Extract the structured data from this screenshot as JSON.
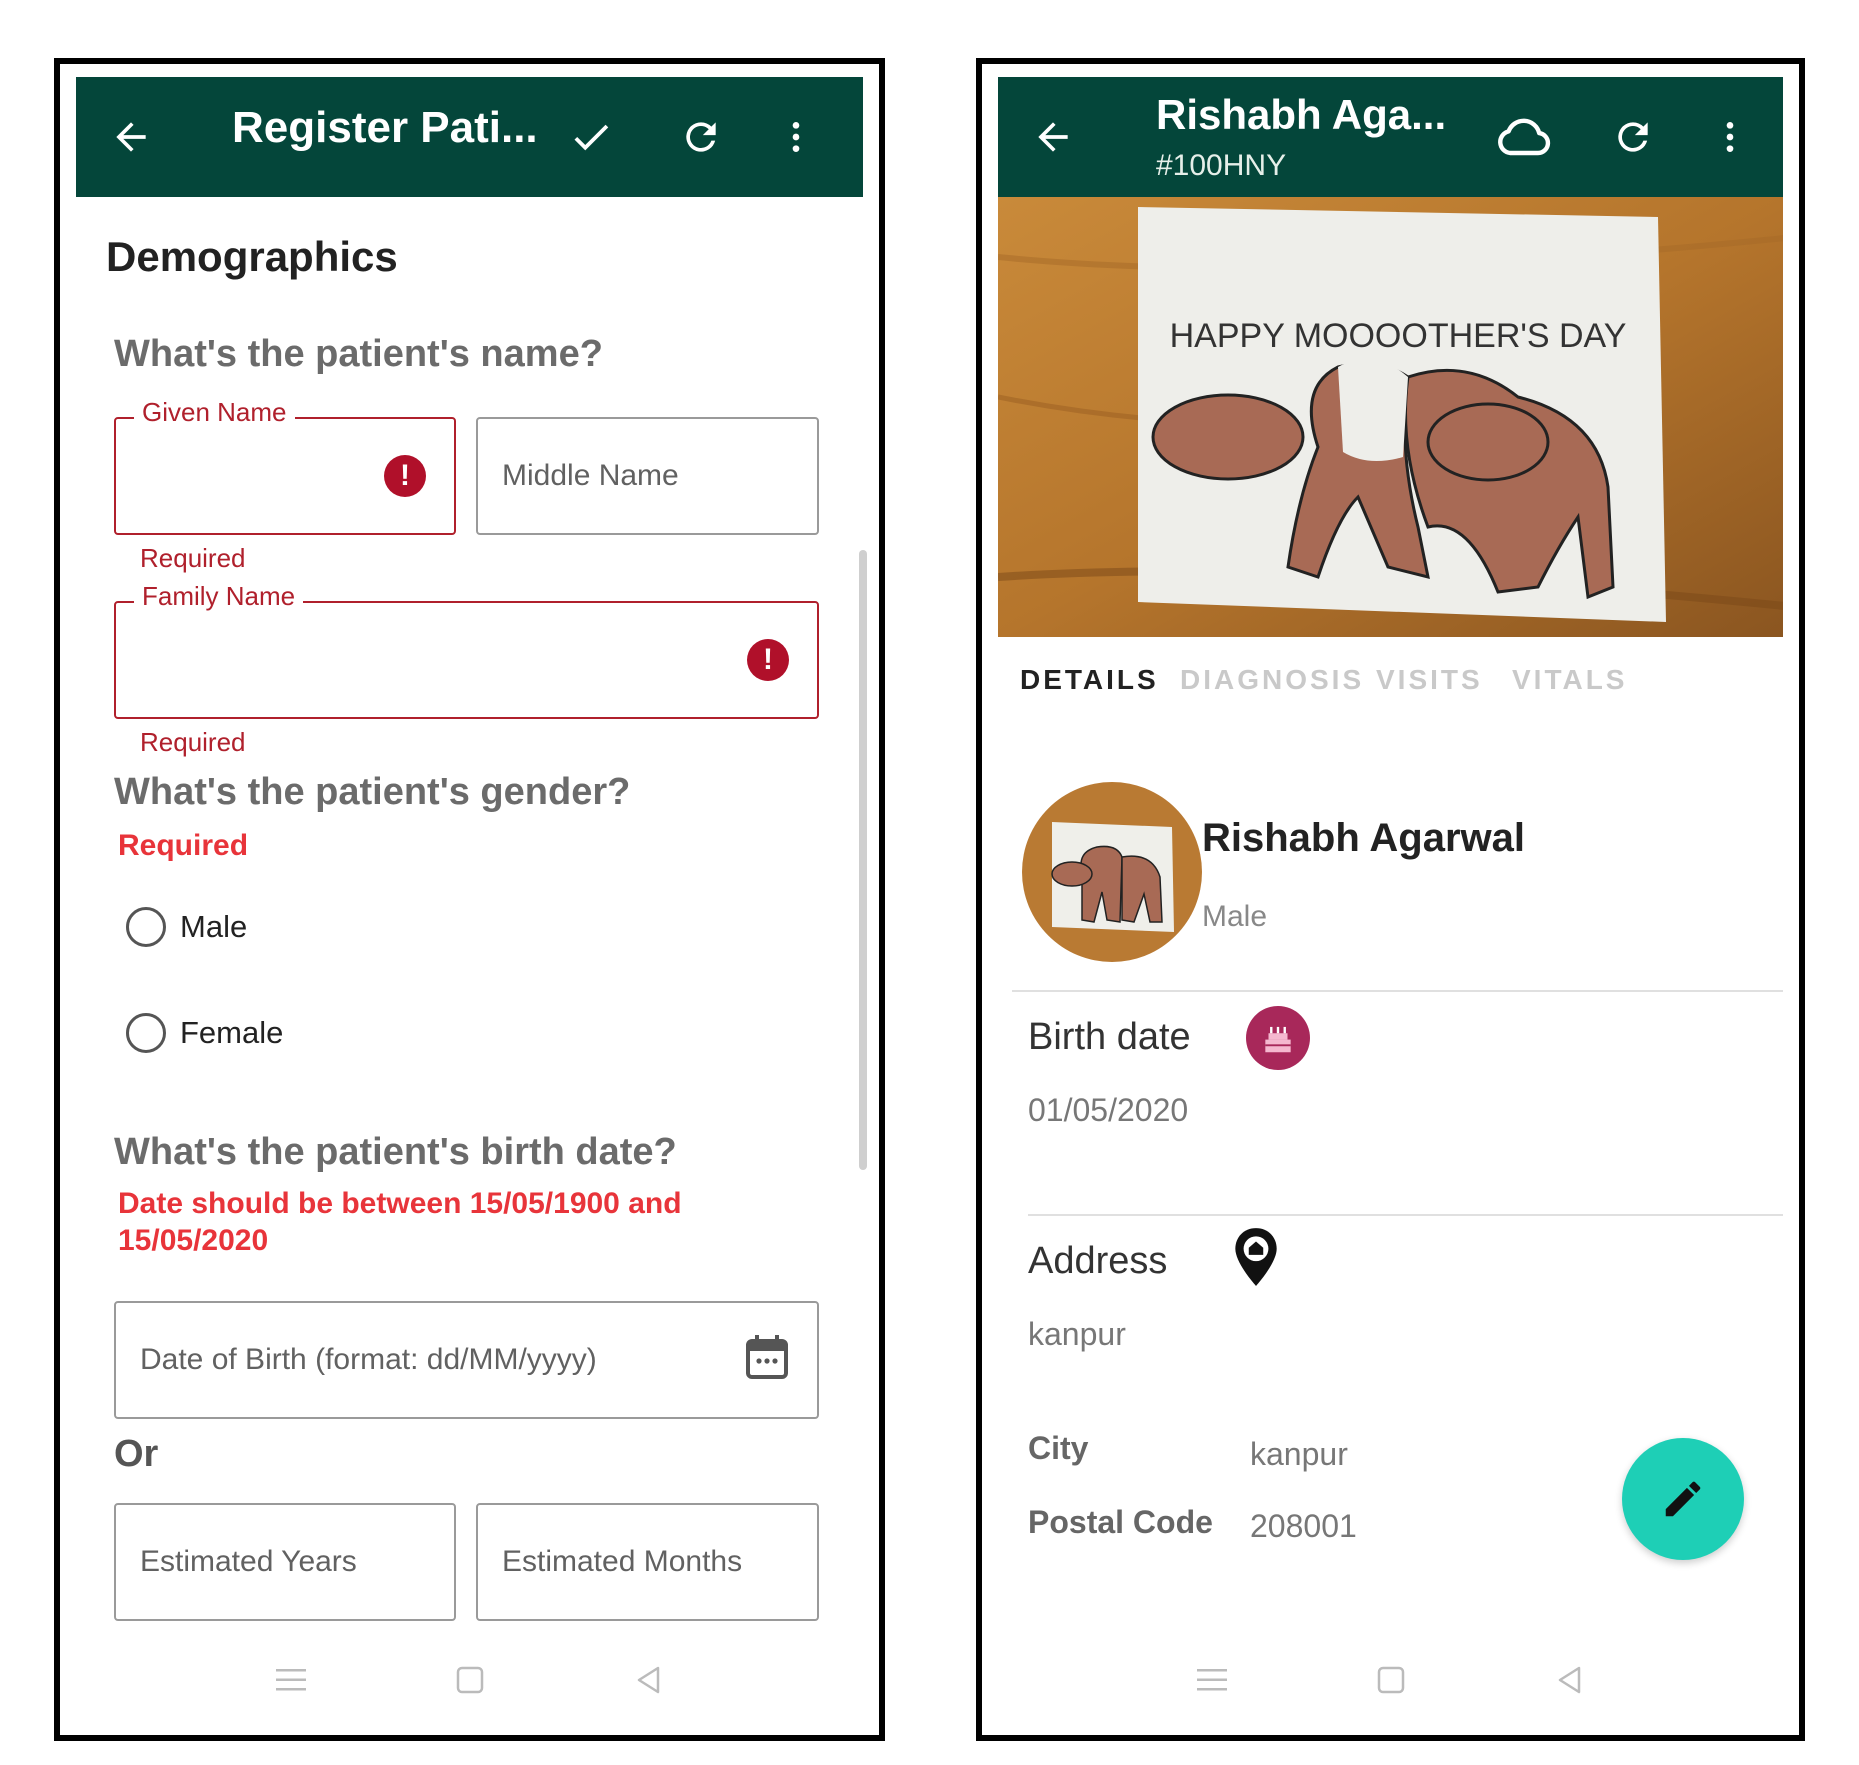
{
  "left_screen": {
    "appbar": {
      "title": "Register Pati...",
      "icons": [
        "back-arrow-icon",
        "check-icon",
        "refresh-icon",
        "more-vert-icon"
      ]
    },
    "section_heading": "Demographics",
    "name_question": "What's the patient's name?",
    "given_name": {
      "label": "Given Name",
      "helper": "Required",
      "value": ""
    },
    "middle_name": {
      "placeholder": "Middle Name",
      "value": ""
    },
    "family_name": {
      "label": "Family Name",
      "helper": "Required",
      "value": ""
    },
    "gender_question": "What's the patient's gender?",
    "gender_error": "Required",
    "gender_options": [
      "Male",
      "Female"
    ],
    "birth_question": "What's the patient's birth date?",
    "birth_error": "Date should be between 15/05/1900 and 15/05/2020",
    "dob_placeholder": "Date of Birth (format: dd/MM/yyyy)",
    "or_text": "Or",
    "estimated_years_placeholder": "Estimated Years",
    "estimated_months_placeholder": "Estimated Months"
  },
  "right_screen": {
    "appbar": {
      "title": "Rishabh Aga...",
      "subtitle": "#100HNY",
      "icons": [
        "back-arrow-icon",
        "cloud-icon",
        "refresh-icon",
        "more-vert-icon"
      ]
    },
    "hero_card_text": "HAPPY MOOOOTHER'S DAY",
    "tabs": [
      "DETAILS",
      "DIAGNOSIS",
      "VISITS",
      "VITALS"
    ],
    "active_tab": "DETAILS",
    "patient": {
      "name": "Rishabh Agarwal",
      "gender": "Male"
    },
    "birth": {
      "label": "Birth date",
      "value": "01/05/2020"
    },
    "address": {
      "label": "Address",
      "value": "kanpur",
      "city_label": "City",
      "city_value": "kanpur",
      "postal_label": "Postal Code",
      "postal_value": "208001"
    }
  },
  "colors": {
    "appbar": "#04463a",
    "error": "#b0202c",
    "error_text": "#e8343a",
    "fab": "#1ecfb6",
    "birth_icon_bg": "#a8285a"
  }
}
